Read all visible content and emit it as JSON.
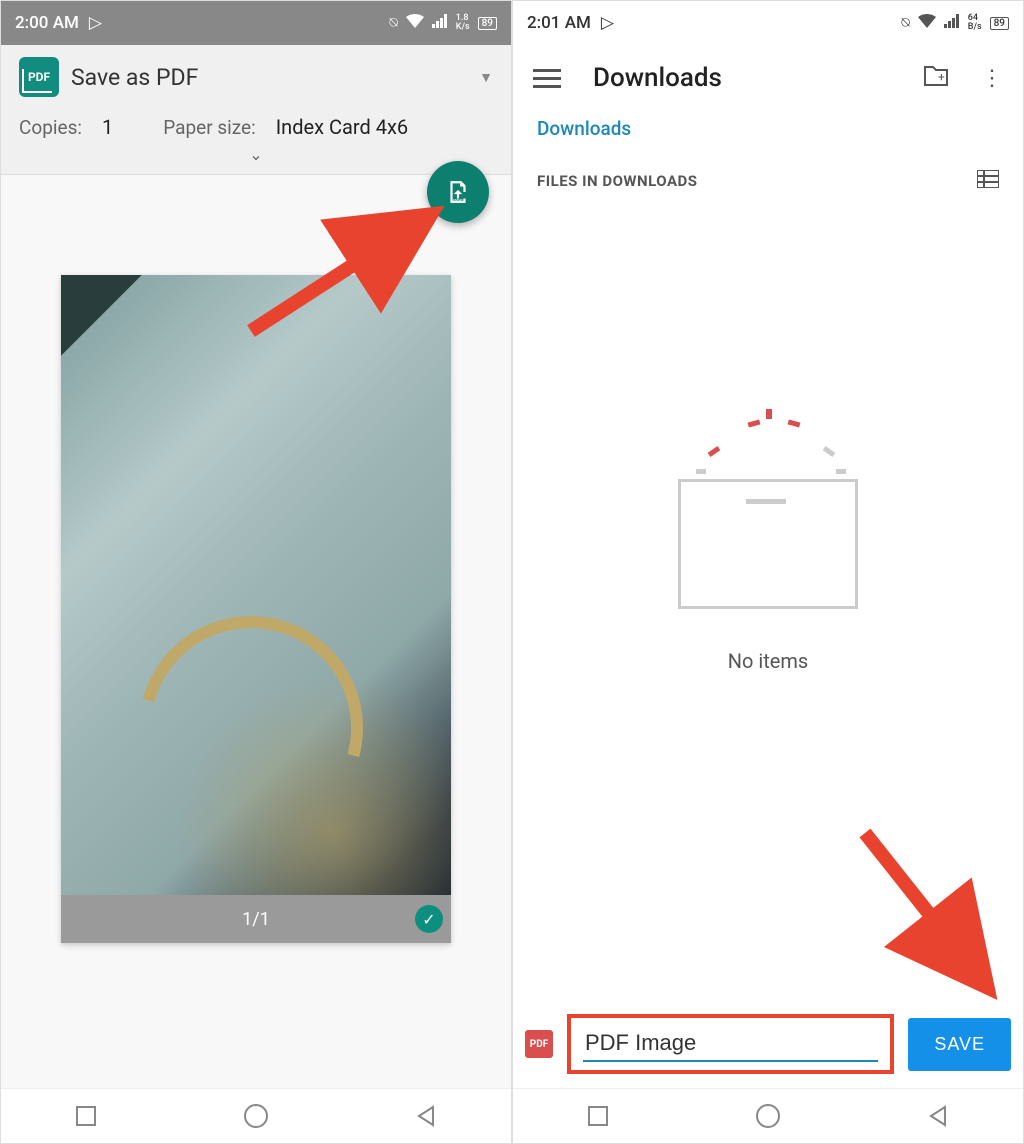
{
  "left": {
    "status": {
      "time": "2:00 AM",
      "battery": "89"
    },
    "printer": {
      "title": "Save as PDF",
      "copies_label": "Copies:",
      "copies_value": "1",
      "papersize_label": "Paper size:",
      "papersize_value": "Index Card 4x6"
    },
    "preview": {
      "page_counter": "1/1"
    }
  },
  "right": {
    "status": {
      "time": "2:01 AM",
      "battery": "89"
    },
    "appbar": {
      "title": "Downloads"
    },
    "breadcrumb": "Downloads",
    "section_label": "FILES IN DOWNLOADS",
    "empty_text": "No items",
    "filename_value": "PDF Image",
    "save_label": "SAVE"
  },
  "icons": {
    "pdf": "PDF"
  }
}
